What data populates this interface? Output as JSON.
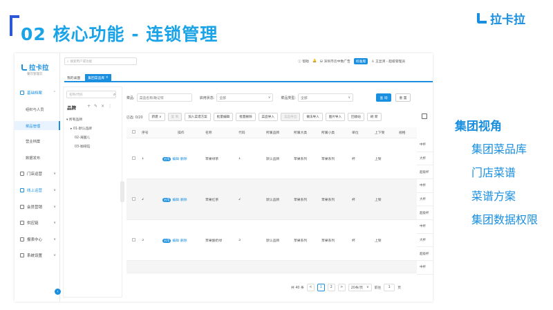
{
  "slide": {
    "title": "02 核心功能 - 连锁管理",
    "logo_text": "拉卡拉",
    "side_heading": "集团视角",
    "side_items": [
      "集团菜品库",
      "门店菜谱",
      "菜谱方案",
      "集团数据权限"
    ]
  },
  "app": {
    "logo_text": "拉卡拉",
    "logo_sub": "餐饮管理云",
    "search_placeholder": "搜索用户或功能",
    "top_right": {
      "help": "帮助",
      "store": "深圳市云中数广告",
      "badge": "标准版",
      "user": "王显贤 - 超级管理员"
    },
    "tabs": [
      "我的桌面",
      "集团菜品库"
    ],
    "tab_close": "×",
    "sidebar": [
      {
        "label": "基础档案",
        "icon": "archive-icon",
        "expanded": true
      },
      {
        "label": "组织与人员",
        "sub": true
      },
      {
        "label": "菜品管理",
        "sub": true,
        "current": true
      },
      {
        "label": "营业档案",
        "sub": true
      },
      {
        "label": "数据发布",
        "sub": true
      },
      {
        "label": "门店运营",
        "icon": "store-icon"
      },
      {
        "label": "线上运营",
        "icon": "online-icon",
        "active": true
      },
      {
        "label": "会员营销",
        "icon": "member-icon"
      },
      {
        "label": "供应链",
        "icon": "supply-icon"
      },
      {
        "label": "报表中心",
        "icon": "report-icon"
      },
      {
        "label": "系统设置",
        "icon": "settings-icon"
      }
    ],
    "tree": {
      "search_placeholder": "名称/代码",
      "title": "品牌",
      "nodes": [
        "所有品牌",
        "01-默认品牌",
        "02-海国儿",
        "03-咖啡馆"
      ]
    },
    "filters": {
      "dish_label": "菜品:",
      "dish_placeholder": "菜品名称/助记符",
      "status_label": "启用状态:",
      "status_value": "全部",
      "type_label": "菜品类型:",
      "type_value": "全部",
      "query_btn": "查 询",
      "reset_btn": "重 置"
    },
    "toolbar": {
      "selected": "已选: 0/20",
      "buttons": [
        "新建 ∨",
        "复 制",
        "加入菜谱方案",
        "批量编辑",
        "批量删除",
        "菜品导入",
        "菜品导出",
        "做法导入",
        "图片导入",
        "回收站",
        "刷 新"
      ],
      "disabled": [
        false,
        true,
        false,
        false,
        false,
        false,
        true,
        false,
        false,
        false,
        false
      ]
    },
    "table": {
      "headers": [
        "序号",
        "操作",
        "名称",
        "代码",
        "所属品牌",
        "所属大类",
        "所属小类",
        "单位",
        "上下架",
        "规格"
      ],
      "toggle_label": "启用",
      "edit_label": "编辑",
      "delete_label": "删除",
      "rows": [
        {
          "index": "1",
          "name": "苹果绿茶",
          "code": "1",
          "brand": "默认品牌",
          "category": "苹果系列",
          "subcategory": "苹果系列",
          "unit": "杯",
          "shelf": "上架",
          "specs": [
            "中杯",
            "大杯",
            "超级杯"
          ]
        },
        {
          "index": "2",
          "name": "苹果红茶",
          "code": "2",
          "brand": "默认品牌",
          "category": "苹果系列",
          "subcategory": "苹果系列",
          "unit": "杯",
          "shelf": "上架",
          "specs": [
            "中杯",
            "大杯",
            "超级杯"
          ]
        },
        {
          "index": "3",
          "name": "苹果酸奶绿",
          "code": "3",
          "brand": "默认品牌",
          "category": "苹果系列",
          "subcategory": "苹果系列",
          "unit": "杯",
          "shelf": "上架",
          "specs": [
            "中杯",
            "大杯",
            "超级杯"
          ]
        }
      ],
      "extra_spec": "中杯"
    },
    "pager": {
      "total": "共 40 条",
      "prev": "<",
      "pages": [
        "1",
        "2"
      ],
      "next": ">",
      "size": "20条/页",
      "goto": "前往",
      "page_input": "1",
      "page_unit": "页"
    }
  }
}
